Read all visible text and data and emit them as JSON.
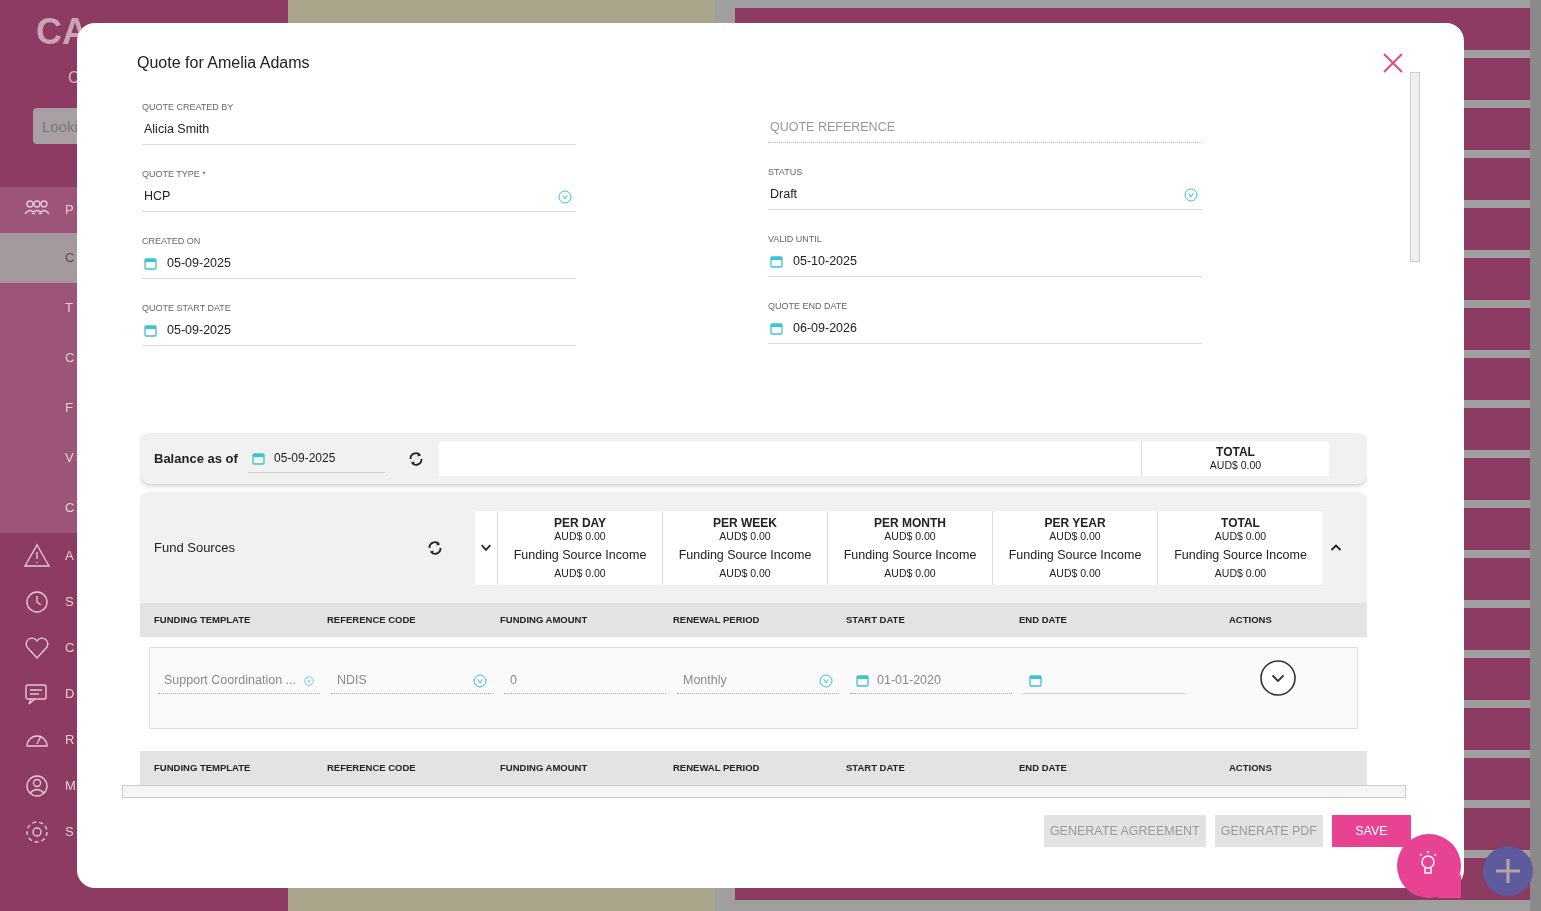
{
  "sidebar": {
    "logo_fragment": "CA",
    "subtitle_fragment": "C",
    "search_placeholder": "Looki",
    "items": [
      {
        "label": "P",
        "kind": "section",
        "selected": false
      },
      {
        "label": "C",
        "kind": "sub",
        "selected": true
      },
      {
        "label": "T",
        "kind": "sub",
        "selected": false
      },
      {
        "label": "C",
        "kind": "sub",
        "selected": false
      },
      {
        "label": "F",
        "kind": "sub",
        "selected": false
      },
      {
        "label": "V",
        "kind": "sub",
        "selected": false
      },
      {
        "label": "C",
        "kind": "sub",
        "selected": false
      },
      {
        "label": "A",
        "kind": "section",
        "selected": false
      },
      {
        "label": "S",
        "kind": "section",
        "selected": false
      },
      {
        "label": "C",
        "kind": "section",
        "selected": false
      },
      {
        "label": "D",
        "kind": "section",
        "selected": false
      },
      {
        "label": "R",
        "kind": "section",
        "selected": false
      },
      {
        "label": "M",
        "kind": "section",
        "selected": false
      },
      {
        "label": "S",
        "kind": "section",
        "selected": false
      }
    ]
  },
  "dialog": {
    "title": "Quote for Amelia Adams",
    "left_fields": [
      {
        "label": "QUOTE CREATED BY",
        "value": "Alicia Smith",
        "kind": "text"
      },
      {
        "label": "QUOTE TYPE *",
        "value": "HCP",
        "kind": "select"
      },
      {
        "label": "CREATED ON",
        "value": "05-09-2025",
        "kind": "date"
      },
      {
        "label": "QUOTE START DATE",
        "value": "05-09-2025",
        "kind": "date"
      }
    ],
    "right_fields": [
      {
        "placeholder": "QUOTE REFERENCE",
        "kind": "readonly"
      },
      {
        "label": "STATUS",
        "value": "Draft",
        "kind": "select"
      },
      {
        "label": "VALID UNTIL",
        "value": "05-10-2025",
        "kind": "date"
      },
      {
        "label": "QUOTE END DATE",
        "value": "06-09-2026",
        "kind": "date"
      }
    ],
    "balance": {
      "label": "Balance as of",
      "date": "05-09-2025",
      "total_heading": "TOTAL",
      "total_amount": "AUD$ 0.00"
    },
    "fund_sources": {
      "title": "Fund Sources",
      "expanded": true,
      "summary": [
        {
          "heading": "PER DAY",
          "amount": "AUD$ 0.00",
          "income_label": "Funding Source Income",
          "income_amount": "AUD$ 0.00"
        },
        {
          "heading": "PER WEEK",
          "amount": "AUD$ 0.00",
          "income_label": "Funding Source Income",
          "income_amount": "AUD$ 0.00"
        },
        {
          "heading": "PER MONTH",
          "amount": "AUD$ 0.00",
          "income_label": "Funding Source Income",
          "income_amount": "AUD$ 0.00"
        },
        {
          "heading": "PER YEAR",
          "amount": "AUD$ 0.00",
          "income_label": "Funding Source Income",
          "income_amount": "AUD$ 0.00"
        },
        {
          "heading": "TOTAL",
          "amount": "AUD$ 0.00",
          "income_label": "Funding Source Income",
          "income_amount": "AUD$ 0.00"
        }
      ],
      "columns": [
        "FUNDING TEMPLATE",
        "REFERENCE CODE",
        "FUNDING AMOUNT",
        "RENEWAL PERIOD",
        "START DATE",
        "END DATE",
        "ACTIONS"
      ],
      "row": [
        {
          "value": "Support Coordination ...",
          "kind": "select"
        },
        {
          "value": "NDIS",
          "kind": "select"
        },
        {
          "value": "0",
          "kind": "text"
        },
        {
          "value": "Monthly",
          "kind": "select"
        },
        {
          "value": "01-01-2020",
          "kind": "date"
        },
        {
          "kind": "date"
        }
      ],
      "next_columns": [
        "FUNDING TEMPLATE",
        "REFERENCE CODE",
        "FUNDING AMOUNT",
        "RENEWAL PERIOD",
        "START DATE",
        "END DATE",
        "ACTIONS"
      ]
    },
    "buttons": [
      {
        "label": "GENERATE AGREEMENT",
        "disabled": true
      },
      {
        "label": "GENERATE PDF",
        "disabled": true
      },
      {
        "label": "SAVE",
        "disabled": false
      }
    ]
  }
}
